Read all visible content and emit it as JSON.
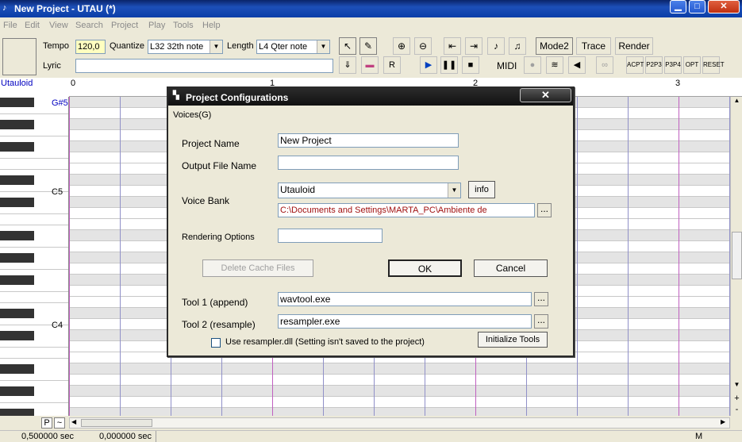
{
  "window": {
    "title": "New Project - UTAU (*)",
    "minimize": "▁",
    "maximize": "□",
    "close": "✕"
  },
  "menu": [
    "File",
    "Edit",
    "View",
    "Search",
    "Project",
    "Play",
    "Tools",
    "Help"
  ],
  "toolbar": {
    "tempo_label": "Tempo",
    "tempo_value": "120,0",
    "quantize_label": "Quantize",
    "quantize_value": "L32 32th note",
    "length_label": "Length",
    "length_value": "L4  Qter note",
    "lyric_label": "Lyric",
    "lyric_value": "",
    "mode2": "Mode2",
    "trace": "Trace",
    "render": "Render",
    "midi": "MIDI"
  },
  "piano_roll": {
    "voice_name": "Utauloid",
    "ruler_marks": [
      "0",
      "1",
      "2",
      "3"
    ],
    "note_labels": [
      "G#5",
      "C5",
      "C4"
    ]
  },
  "bottom": {
    "p_button": "P",
    "tilde": "~"
  },
  "status": {
    "pos1": "0,500000 sec",
    "pos2": "0,000000 sec",
    "mode": "M"
  },
  "dialog": {
    "title": "Project Configurations",
    "close": "✕",
    "voices_label": "Voices(G)",
    "project_name_label": "Project Name",
    "project_name_value": "New Project",
    "output_file_label": "Output File Name",
    "output_file_value": "",
    "voice_bank_label": "Voice Bank",
    "voice_bank_value": "Utauloid",
    "info_button": "info",
    "voice_path": "C:\\Documents and Settings\\MARTA_PC\\Ambiente de",
    "ellipsis": "...",
    "rendering_label": "Rendering Options",
    "rendering_value": "",
    "delete_cache": "Delete Cache Files",
    "ok": "OK",
    "cancel": "Cancel",
    "tool1_label": "Tool 1 (append)",
    "tool1_value": "wavtool.exe",
    "tool2_label": "Tool 2 (resample)",
    "tool2_value": "resampler.exe",
    "resampler_dll": "Use resampler.dll (Setting isn't saved to the project)",
    "init_tools": "Initialize Tools"
  },
  "colors": {
    "path_text": "#a01010",
    "voice_name": "#0000c0"
  }
}
